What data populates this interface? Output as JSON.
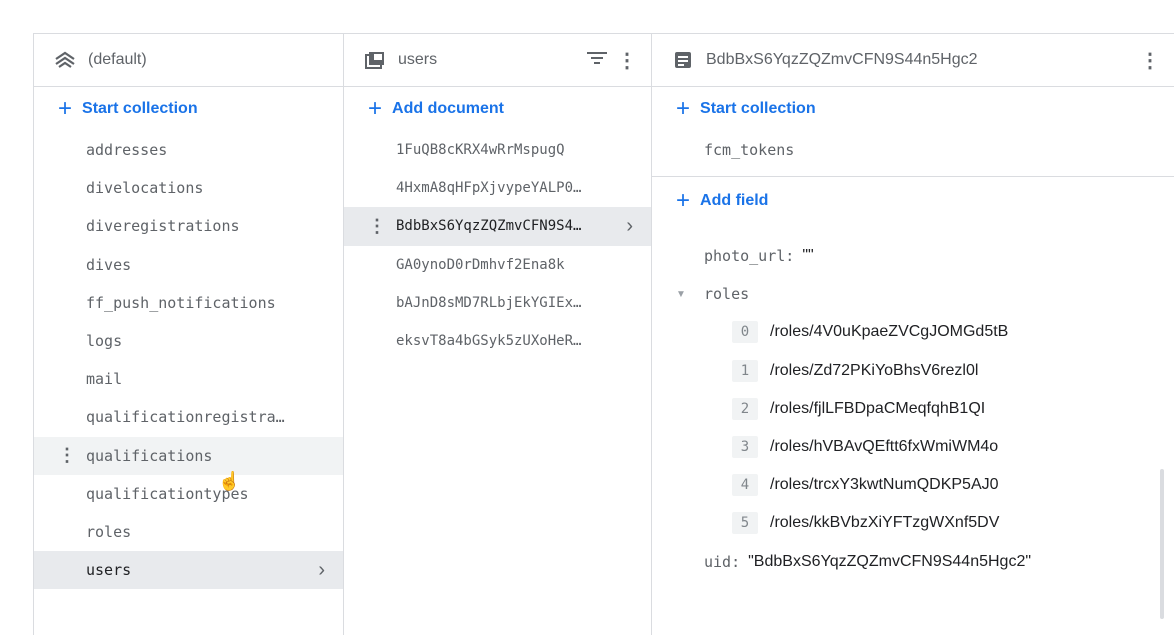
{
  "collections_panel": {
    "title": "(default)",
    "start_collection_label": "Start collection",
    "items": [
      "addresses",
      "divelocations",
      "diveregistrations",
      "dives",
      "ff_push_notifications",
      "logs",
      "mail",
      "qualificationregistra…",
      "qualifications",
      "qualificationtypes",
      "roles",
      "users"
    ],
    "hovered_item": "qualifications",
    "selected_item": "users"
  },
  "documents_panel": {
    "title": "users",
    "add_document_label": "Add document",
    "items": [
      "1FuQB8cKRX4wRrMspugQ",
      "4HxmA8qHFpXjvypeYALP0…",
      "BdbBxS6YqzZQZmvCFN9S4…",
      "GA0ynoD0rDmhvf2Ena8k",
      "bAJnD8sMD7RLbjEkYGIEx…",
      "eksvT8a4bGSyk5zUXoHeR…"
    ],
    "selected_item": "BdbBxS6YqzZQZmvCFN9S4…"
  },
  "document_panel": {
    "title": "BdbBxS6YqzZQZmvCFN9S44n5Hgc2",
    "start_collection_label": "Start collection",
    "subcollections": [
      "fcm_tokens"
    ],
    "add_field_label": "Add field",
    "fields": {
      "photo_url_key": "photo_url:",
      "photo_url_value": "\"\"",
      "roles_key": "roles",
      "roles": [
        {
          "index": "0",
          "value": "/roles/4V0uKpaeZVCgJOMGd5tB"
        },
        {
          "index": "1",
          "value": "/roles/Zd72PKiYoBhsV6rezl0l"
        },
        {
          "index": "2",
          "value": "/roles/fjlLFBDpaCMeqfqhB1QI"
        },
        {
          "index": "3",
          "value": "/roles/hVBAvQEftt6fxWmiWM4o"
        },
        {
          "index": "4",
          "value": "/roles/trcxY3kwtNumQDKP5AJ0"
        },
        {
          "index": "5",
          "value": "/roles/kkBVbzXiYFTzgWXnf5DV"
        }
      ],
      "uid_key": "uid:",
      "uid_value": "\"BdbBxS6YqzZQZmvCFN9S44n5Hgc2\""
    }
  },
  "colors": {
    "accent": "#1a73e8",
    "border": "#dadce0",
    "selected_bg": "#e8eaed",
    "hover_bg": "#f1f3f4"
  }
}
